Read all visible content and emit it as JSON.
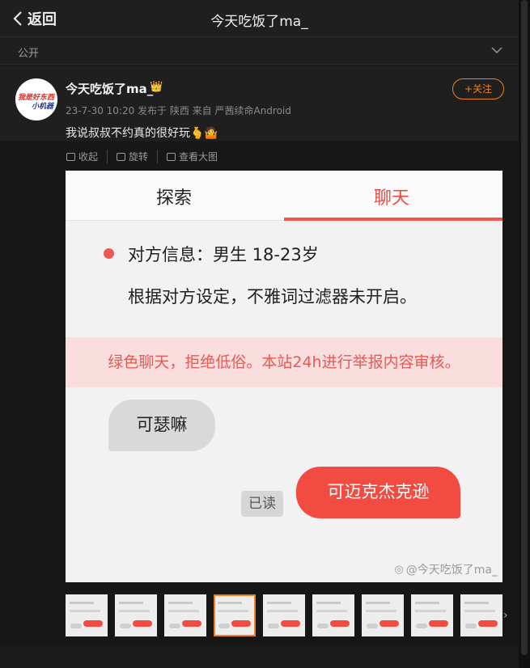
{
  "header": {
    "back_label": "返回",
    "title": "今天吃饭了ma_"
  },
  "visibility": {
    "label": "公开"
  },
  "post": {
    "avatar_line1": "我是好东西",
    "avatar_line2": "小机器",
    "username": "今天吃饭了ma_",
    "meta": "23-7-30 10:20 发布于 陕西  来自 严茜续命Android",
    "text": "我说叔叔不约真的很好玩🫰🤷",
    "follow_label": "+关注"
  },
  "image_tools": {
    "collapse": "收起",
    "rotate": "旋转",
    "view_large": "查看大图"
  },
  "screenshot": {
    "tab_explore": "探索",
    "tab_chat": "聊天",
    "info_line1": "对方信息：男生 18-23岁",
    "info_line2": "根据对方设定，不雅词过滤器未开启。",
    "banner": "绿色聊天，拒绝低俗。本站24h进行举报内容审核。",
    "bubble_left": "可瑟嘛",
    "read_tag": "已读",
    "bubble_right": "可迈克杰克逊",
    "watermark": "@今天吃饭了ma_"
  },
  "thumbnails": {
    "count": 9,
    "active_index": 3,
    "next_icon": "chevron-right-icon"
  },
  "colors": {
    "accent_orange": "#f0801e",
    "chat_red": "#f24b41",
    "banner_bg": "#f9dedd"
  }
}
